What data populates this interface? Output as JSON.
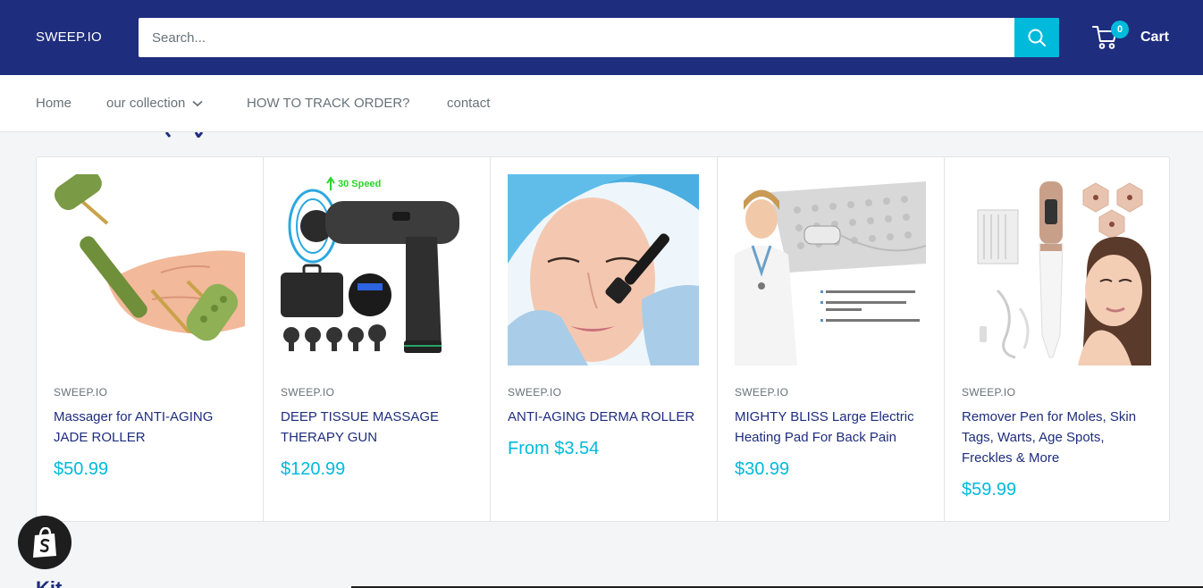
{
  "header": {
    "logo": "SWEEP.IO",
    "search_placeholder": "Search...",
    "cart_label": "Cart",
    "cart_count": "0"
  },
  "nav": {
    "items": [
      {
        "label": "Home"
      },
      {
        "label": "our collection"
      },
      {
        "label": "HOW TO TRACK ORDER?"
      },
      {
        "label": "contact"
      }
    ]
  },
  "products": [
    {
      "vendor": "SWEEP.IO",
      "title": "Massager for ANTI-AGING JADE ROLLER",
      "price": "$50.99"
    },
    {
      "vendor": "SWEEP.IO",
      "title": "DEEP TISSUE MASSAGE THERAPY GUN",
      "price": "$120.99",
      "image_text": "30 Speed"
    },
    {
      "vendor": "SWEEP.IO",
      "title": "ANTI-AGING DERMA ROLLER",
      "price": "From $3.54"
    },
    {
      "vendor": "SWEEP.IO",
      "title": "MIGHTY BLISS Large Electric Heating Pad For Back Pain",
      "price": "$30.99"
    },
    {
      "vendor": "SWEEP.IO",
      "title": "Remover Pen for Moles, Skin Tags, Warts, Age Spots, Freckles & More",
      "price": "$59.99"
    }
  ],
  "next_section_heading": "Kit",
  "colors": {
    "header_bg": "#1e2d7d",
    "accent": "#00badb",
    "link": "#1e2d7d",
    "muted_text": "#677279"
  }
}
